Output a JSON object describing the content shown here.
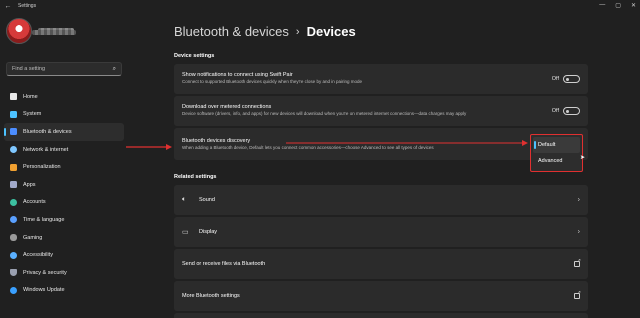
{
  "window": {
    "title": "Settings",
    "back_glyph": "←",
    "controls": [
      "—",
      "▢",
      "✕"
    ]
  },
  "sidebar": {
    "search_placeholder": "Find a setting",
    "items": [
      {
        "label": "Home",
        "icon": "home-icon",
        "color": "#e8e8e8"
      },
      {
        "label": "System",
        "icon": "system-icon",
        "color": "#4cc2ff"
      },
      {
        "label": "Bluetooth & devices",
        "icon": "bluetooth-icon",
        "color": "#4c8dff",
        "active": true
      },
      {
        "label": "Network & internet",
        "icon": "network-icon",
        "color": "#7fc7ff"
      },
      {
        "label": "Personalization",
        "icon": "personalization-icon",
        "color": "#f0a030"
      },
      {
        "label": "Apps",
        "icon": "apps-icon",
        "color": "#a0a8c8"
      },
      {
        "label": "Accounts",
        "icon": "accounts-icon",
        "color": "#3cc0a0"
      },
      {
        "label": "Time & language",
        "icon": "time-language-icon",
        "color": "#5aa0ff"
      },
      {
        "label": "Gaming",
        "icon": "gaming-icon",
        "color": "#9a9a9a"
      },
      {
        "label": "Accessibility",
        "icon": "accessibility-icon",
        "color": "#5ab0ff"
      },
      {
        "label": "Privacy & security",
        "icon": "privacy-icon",
        "color": "#9aa0b0"
      },
      {
        "label": "Windows Update",
        "icon": "windows-update-icon",
        "color": "#3aa0ff"
      }
    ]
  },
  "header": {
    "parent": "Bluetooth & devices",
    "separator": "›",
    "current": "Devices"
  },
  "device_settings": {
    "title": "Device settings",
    "swift_pair": {
      "title": "Show notifications to connect using Swift Pair",
      "description": "Connect to supported Bluetooth devices quickly when they're close by and in pairing mode",
      "state": "Off"
    },
    "metered": {
      "title": "Download over metered connections",
      "description": "Device software (drivers, info, and apps) for new devices will download when you're on metered internet connections—data charges may apply",
      "state": "Off"
    },
    "discovery": {
      "title": "Bluetooth devices discovery",
      "description": "When adding a Bluetooth device, Default lets you connect common accessories—choose Advanced to see all types of devices",
      "options": [
        "Default",
        "Advanced"
      ],
      "selected": "Default"
    }
  },
  "related_settings": {
    "title": "Related settings",
    "items": [
      {
        "label": "Sound",
        "icon": "speaker-icon",
        "type": "chevron"
      },
      {
        "label": "Display",
        "icon": "display-icon",
        "type": "chevron"
      },
      {
        "label": "Send or receive files via Bluetooth",
        "type": "external"
      },
      {
        "label": "More Bluetooth settings",
        "type": "external"
      }
    ]
  },
  "annotation_color": "#e03030"
}
